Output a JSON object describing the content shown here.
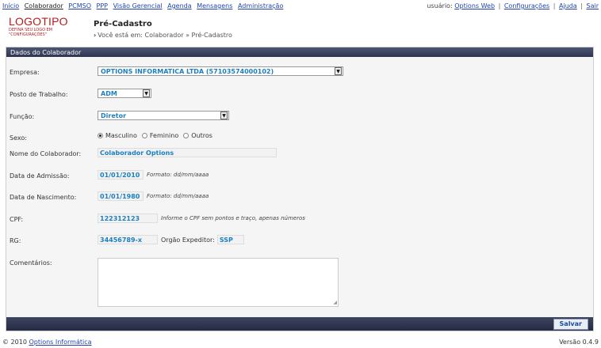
{
  "nav": {
    "items": [
      "Início",
      "Colaborador",
      "PCMSO",
      "PPP",
      "Visão Gerencial",
      "Agenda",
      "Mensagens",
      "Administração"
    ]
  },
  "user": {
    "prefix": "usuário:",
    "name": "Options Web",
    "links": [
      "Configurações",
      "Ajuda",
      "Sair"
    ]
  },
  "logo": {
    "title": "LOGOTIPO",
    "subtitle": "DEFINA SEU LOGO EM \"CONFIGURAÇÕES\""
  },
  "page": {
    "title": "Pré-Cadastro",
    "breadcrumb": "Você está em: Colaborador » Pré-Cadastro"
  },
  "panel": {
    "title": "Dados do Colaborador",
    "save_label": "Salvar"
  },
  "form": {
    "empresa": {
      "label": "Empresa:",
      "value": "OPTIONS INFORMATICA LTDA (57103574000102)"
    },
    "posto": {
      "label": "Posto de Trabalho:",
      "value": "ADM"
    },
    "funcao": {
      "label": "Função:",
      "value": "Diretor"
    },
    "sexo": {
      "label": "Sexo:",
      "options": [
        "Masculino",
        "Feminino",
        "Outros"
      ],
      "selected": "Masculino"
    },
    "nome": {
      "label": "Nome do Colaborador:",
      "value": "Colaborador Options"
    },
    "admissao": {
      "label": "Data de Admissão:",
      "value": "01/01/2010",
      "hint": "Formato: dd/mm/aaaa"
    },
    "nascimento": {
      "label": "Data de Nascimento:",
      "value": "01/01/1980",
      "hint": "Formato: dd/mm/aaaa"
    },
    "cpf": {
      "label": "CPF:",
      "value": "122312123",
      "hint": "Informe o CPF sem pontos e traço, apenas números"
    },
    "rg": {
      "label": "RG:",
      "value": "34456789-x",
      "orgao_label": "Orgão Expeditor:",
      "orgao_value": "SSP"
    },
    "comentarios": {
      "label": "Comentários:",
      "value": ""
    }
  },
  "footer": {
    "copyright": "© 2010",
    "company": "Options Informática",
    "version": "Versão 0.4.9"
  }
}
